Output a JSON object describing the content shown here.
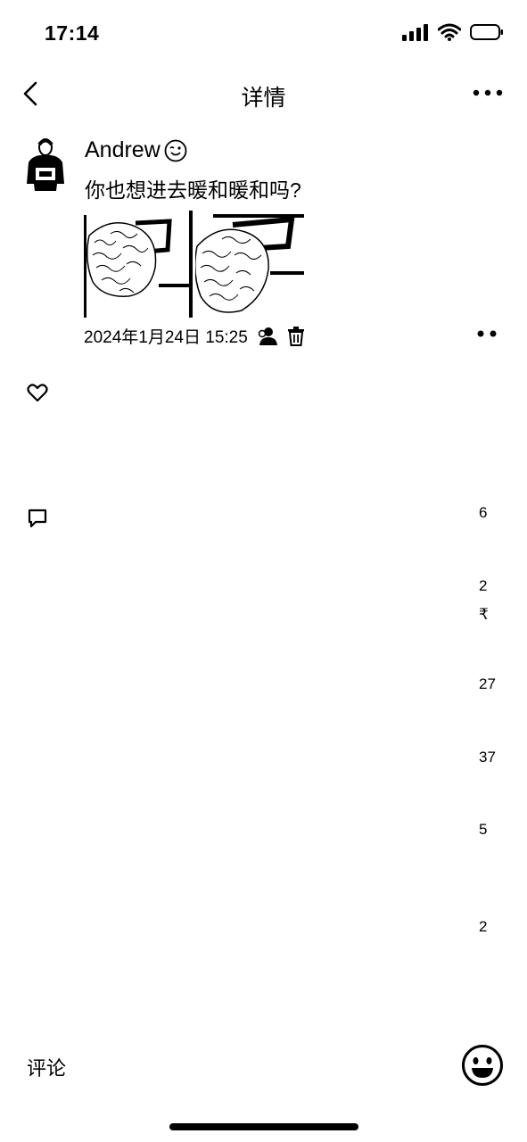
{
  "status_bar": {
    "time": "17:14",
    "icons": [
      "signal-icon",
      "wifi-icon",
      "battery-icon"
    ]
  },
  "nav": {
    "back_icon": "back-chevron-icon",
    "title": "详情",
    "more_icon": "more-icon"
  },
  "post": {
    "author": "Andrew",
    "author_emoji_icon": "wink-emoji-icon",
    "text": "你也想进去暖和暖和吗?",
    "photo_count": 2,
    "timestamp": "2024年1月24日 15:25",
    "meta_icons": [
      "friends-icon",
      "delete-icon"
    ]
  },
  "likes": {
    "icon": "heart-icon"
  },
  "comments": {
    "icon": "comment-icon",
    "partial_values": [
      "6",
      "2",
      "₹",
      "27",
      "37",
      "5",
      "2"
    ]
  },
  "footer": {
    "comment_placeholder": "评论",
    "emoji_icon": "smile-emoji-icon"
  }
}
